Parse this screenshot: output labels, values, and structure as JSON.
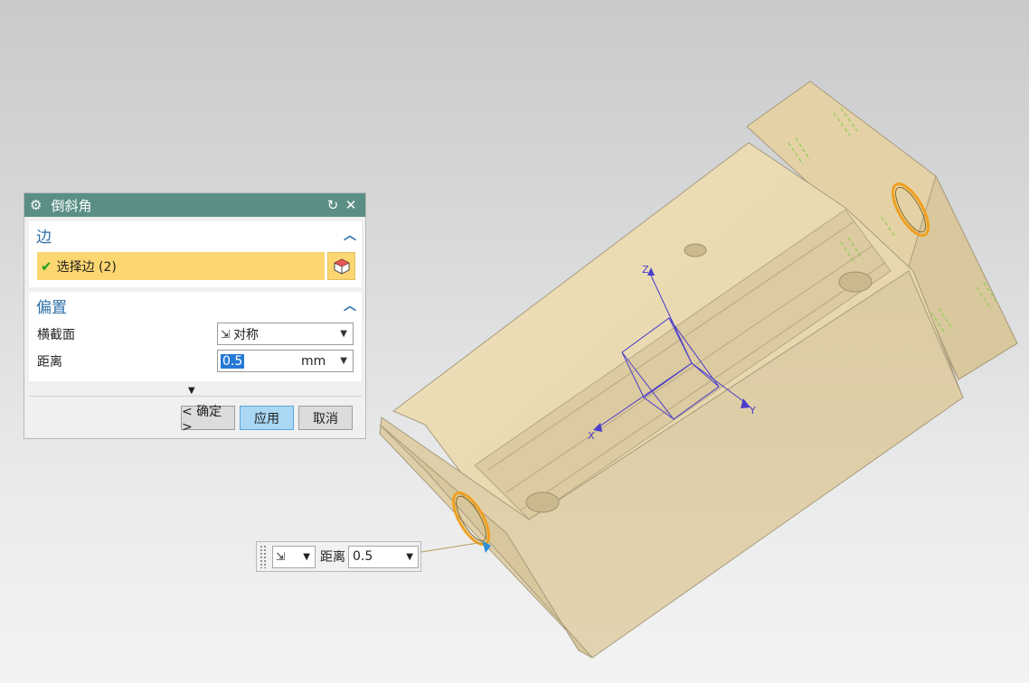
{
  "dialog": {
    "title": "倒斜角",
    "reset_icon": "reset-icon",
    "close_icon": "close-icon",
    "edge_section": {
      "label": "边",
      "select_label": "选择边 (2)"
    },
    "offset_section": {
      "label": "偏置",
      "cross_section_label": "横截面",
      "cross_section_value": "对称",
      "distance_label": "距离",
      "distance_value": "0.5",
      "distance_unit": "mm"
    },
    "buttons": {
      "ok": "< 确定 >",
      "apply": "应用",
      "cancel": "取消"
    }
  },
  "floating_bar": {
    "distance_label": "距离",
    "distance_value": "0.5"
  },
  "viewport": {
    "axis_labels": {
      "z": "Z",
      "y": "Y",
      "x": "X"
    },
    "part_color": "#e6d4a8",
    "highlight_color": "#f0a020",
    "csys_color": "#4a3ccc"
  }
}
